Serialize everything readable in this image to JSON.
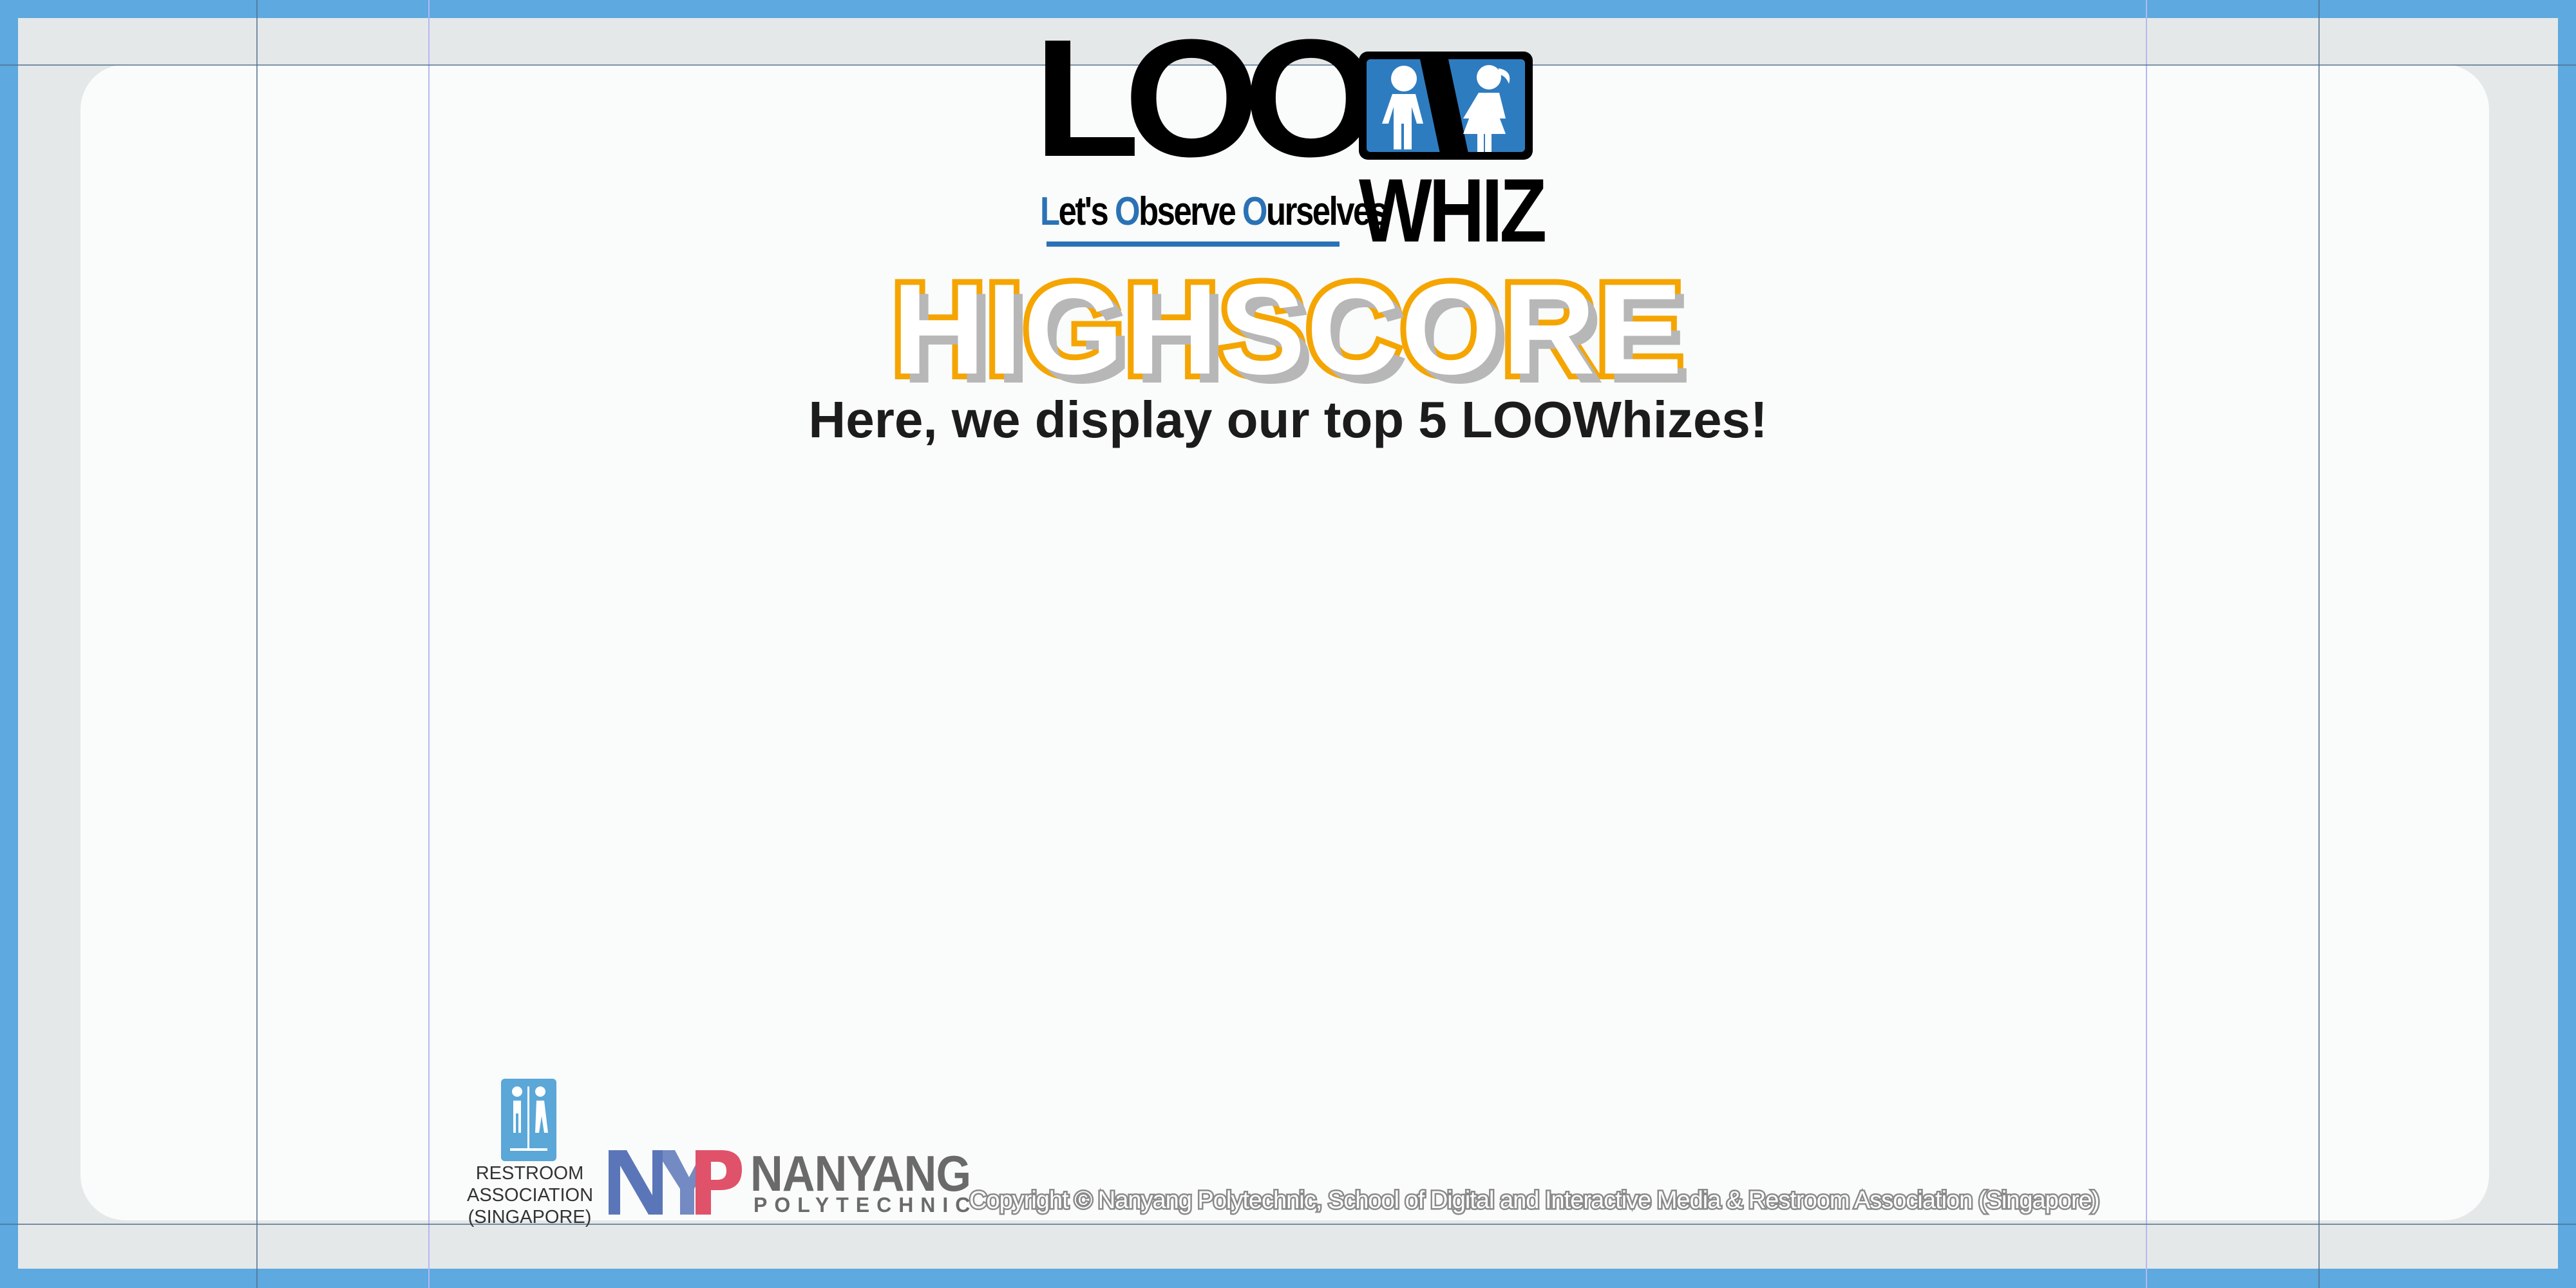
{
  "logo": {
    "loo": "LOO",
    "whiz": "WHIZ",
    "tagline_parts": [
      "L",
      "et's ",
      "O",
      "bserve ",
      "O",
      "urselves"
    ],
    "icons": [
      "boy-icon",
      "girl-icon"
    ]
  },
  "title": "HIGHSCORE",
  "subtitle": "Here, we display our top 5 LOOWhizes!",
  "footer": {
    "ra_lines": [
      "RESTROOM",
      "ASSOCIATION",
      "(SINGAPORE)"
    ],
    "nyp_name": "NANYANG",
    "nyp_sub": "POLYTECHNIC",
    "copyright": "Copyright © Nanyang Polytechnic, School of Digital and Interactive Media & Restroom Association (Singapore)"
  },
  "colors": {
    "background": "#5da9e0",
    "frame": "#e5e8e8",
    "panel": "#fafbfb",
    "title_outline": "#f5a500",
    "accent_blue": "#2a72b5",
    "nyp_red": "#e0526a",
    "nyp_blue": "#5b76b8"
  }
}
